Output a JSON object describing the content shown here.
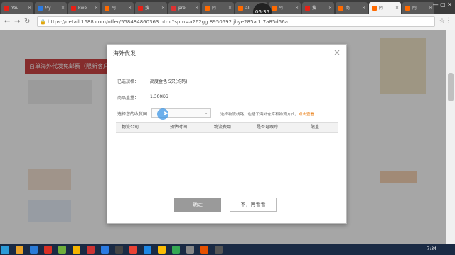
{
  "browser": {
    "tabs": [
      {
        "label": "You",
        "color": "#e62117"
      },
      {
        "label": "My",
        "color": "#2a7ae2"
      },
      {
        "label": "kwo",
        "color": "#e62117"
      },
      {
        "label": "阿",
        "color": "#ff6a00"
      },
      {
        "label": "搜",
        "color": "#e62117"
      },
      {
        "label": "pro",
        "color": "#d33"
      },
      {
        "label": "阿",
        "color": "#ff6a00"
      },
      {
        "label": "ali",
        "color": "#ff6a00"
      },
      {
        "label": "阿",
        "color": "#ff6a00"
      },
      {
        "label": "搜",
        "color": "#e62117"
      },
      {
        "label": "商",
        "color": "#ff6a00"
      },
      {
        "label": "阿",
        "color": "#ff6a00"
      },
      {
        "label": "阿",
        "color": "#ff6a00"
      }
    ],
    "timer": "06:35",
    "url_scheme": "https://",
    "url": "https://detail.1688.com/offer/558484860363.html?spm=a262gg.8950592.jbye285a.1.7a85d56a..."
  },
  "background": {
    "banner_text": "首单海外代发免邮费（限新客户）"
  },
  "modal": {
    "title": "海外代发",
    "close_glyph": "×",
    "rows": [
      {
        "label": "已选规格：",
        "value": "高度金色 5只(均码)"
      },
      {
        "label": "商品重量：",
        "value": "1.300KG"
      }
    ],
    "select_label": "选择您的收货国：",
    "select_placeholder": "",
    "note_text": "选择物流线路，包括了海外仓库和物流方式，",
    "note_link": "点击查看",
    "table_headers": [
      "物流公司",
      "预估时间",
      "物流费用",
      "是否可跟踪",
      "限重"
    ],
    "ok_label": "确定",
    "cancel_label": "不，再看看"
  },
  "taskbar": {
    "time": "7:34",
    "icons": [
      "#e9a22a",
      "#2b7bd8",
      "#d93025",
      "#6fae3b",
      "#f4b400",
      "#c33",
      "#2a7ae2",
      "#444",
      "#ea4335",
      "#1e88e5",
      "#fbbc05",
      "#34a853",
      "#888",
      "#e65100",
      "#555"
    ]
  }
}
